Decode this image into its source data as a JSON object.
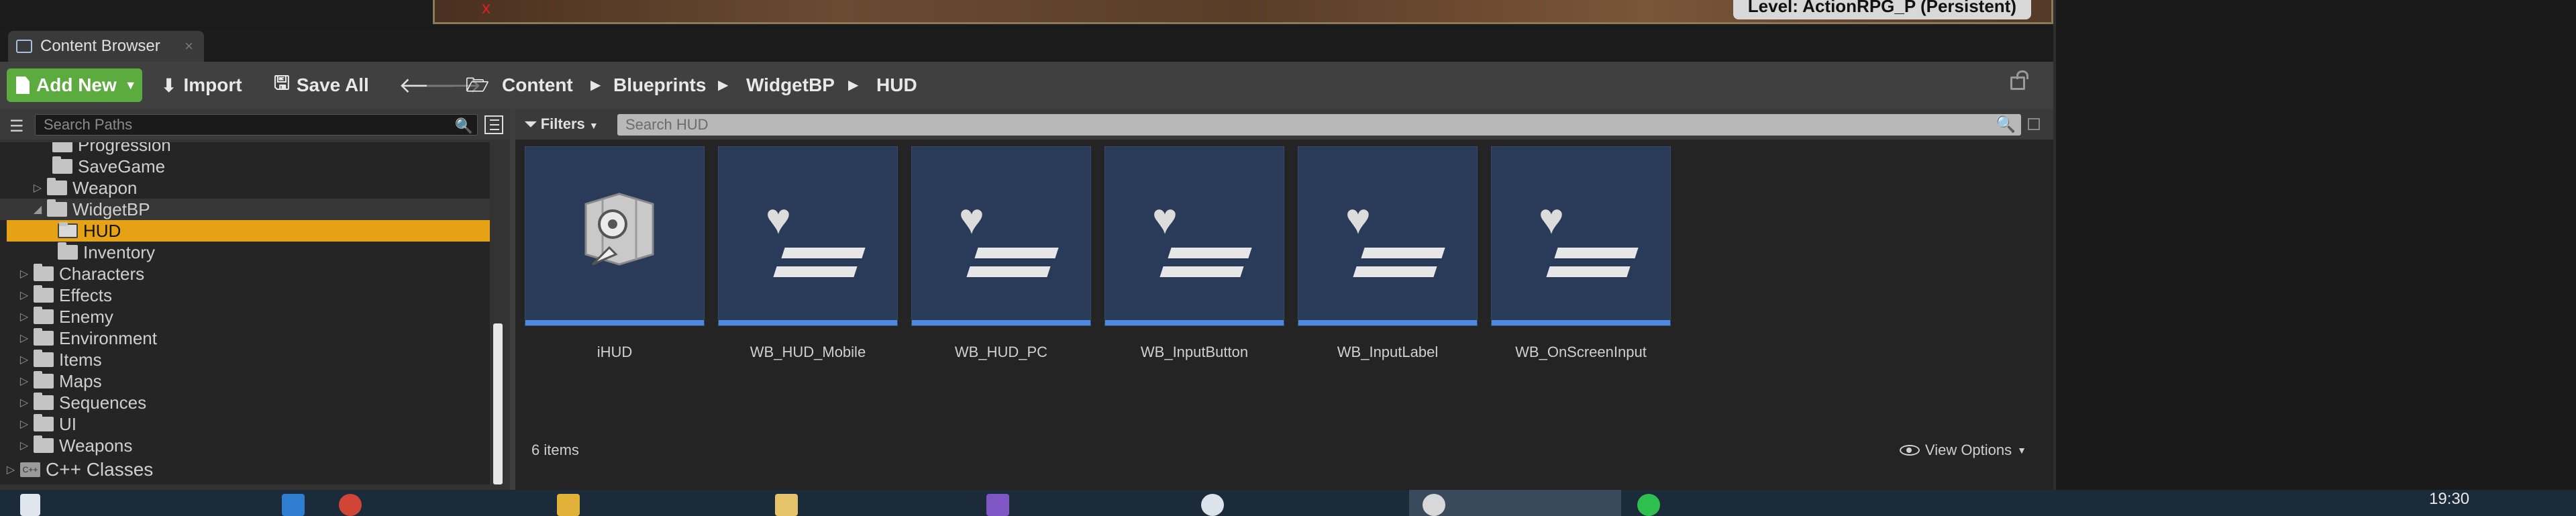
{
  "level_badge": "Level:  ActionRPG_P (Persistent)",
  "tab": {
    "label": "Content Browser",
    "close": "×"
  },
  "toolbar": {
    "add_new": "Add New",
    "import": "Import",
    "save_all": "Save All",
    "breadcrumbs": [
      "Content",
      "Blueprints",
      "WidgetBP",
      "HUD"
    ]
  },
  "paths": {
    "search_placeholder": "Search Paths",
    "tree": [
      {
        "label": "Progression",
        "expandable": false
      },
      {
        "label": "SaveGame",
        "expandable": false
      },
      {
        "label": "Weapon",
        "expandable": true
      },
      {
        "label": "WidgetBP",
        "expandable": true,
        "expanded": true
      },
      {
        "label": "HUD",
        "expandable": false,
        "selected": true
      },
      {
        "label": "Inventory",
        "expandable": false
      },
      {
        "label": "Characters",
        "expandable": true
      },
      {
        "label": "Effects",
        "expandable": true
      },
      {
        "label": "Enemy",
        "expandable": true
      },
      {
        "label": "Environment",
        "expandable": true
      },
      {
        "label": "Items",
        "expandable": true
      },
      {
        "label": "Maps",
        "expandable": true
      },
      {
        "label": "Sequences",
        "expandable": true
      },
      {
        "label": "UI",
        "expandable": true
      },
      {
        "label": "Weapons",
        "expandable": true
      }
    ],
    "cpp_classes": "C++ Classes"
  },
  "assets": {
    "filters_label": "Filters",
    "search_placeholder": "Search HUD",
    "items": [
      {
        "name": "iHUD",
        "icon": "map-gear-icon"
      },
      {
        "name": "WB_HUD_Mobile",
        "icon": "widget-blueprint-icon"
      },
      {
        "name": "WB_HUD_PC",
        "icon": "widget-blueprint-icon"
      },
      {
        "name": "WB_InputButton",
        "icon": "widget-blueprint-icon"
      },
      {
        "name": "WB_InputLabel",
        "icon": "widget-blueprint-icon"
      },
      {
        "name": "WB_OnScreenInput",
        "icon": "widget-blueprint-icon"
      }
    ],
    "count_text": "6 items",
    "view_options": "View Options"
  },
  "taskbar": {
    "clock": "19:30"
  },
  "colors": {
    "accent_green": "#5cab3e",
    "selection": "#e6a215",
    "asset_bar": "#4e88e0"
  }
}
